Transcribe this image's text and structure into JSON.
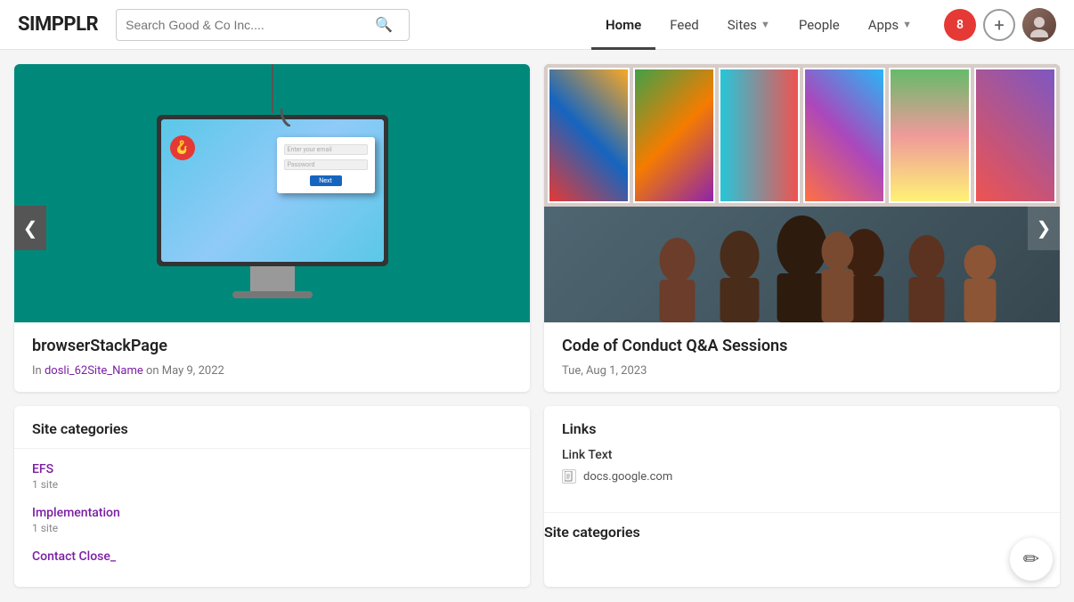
{
  "header": {
    "logo": "SIMPPLR",
    "search": {
      "placeholder": "Search Good & Co Inc....",
      "value": ""
    },
    "nav": [
      {
        "id": "home",
        "label": "Home",
        "active": true,
        "hasDropdown": false
      },
      {
        "id": "feed",
        "label": "Feed",
        "active": false,
        "hasDropdown": false
      },
      {
        "id": "sites",
        "label": "Sites",
        "active": false,
        "hasDropdown": true
      },
      {
        "id": "people",
        "label": "People",
        "active": false,
        "hasDropdown": false
      },
      {
        "id": "apps",
        "label": "Apps",
        "active": false,
        "hasDropdown": true
      }
    ],
    "notification_count": "8",
    "add_button_label": "+",
    "avatar_initial": "👤"
  },
  "carousel": {
    "left": {
      "title": "browserStackPage",
      "meta_prefix": "In ",
      "site_name": "dosli_62Site_Name",
      "meta_suffix": " on May 9, 2022"
    },
    "right": {
      "title": "Code of Conduct Q&A Sessions",
      "date": "Tue, Aug 1, 2023"
    }
  },
  "site_categories": {
    "header": "Site categories",
    "items": [
      {
        "name": "EFS",
        "count": "1 site"
      },
      {
        "name": "Implementation",
        "count": "1 site"
      },
      {
        "name": "Contact Close_",
        "count": ""
      }
    ]
  },
  "links": {
    "header": "Links",
    "groups": [
      {
        "title": "Link Text",
        "items": [
          {
            "label": "docs.google.com",
            "icon": "doc"
          }
        ]
      }
    ]
  },
  "bottom_right": {
    "header": "Site categories"
  },
  "fab": {
    "icon": "✏"
  }
}
